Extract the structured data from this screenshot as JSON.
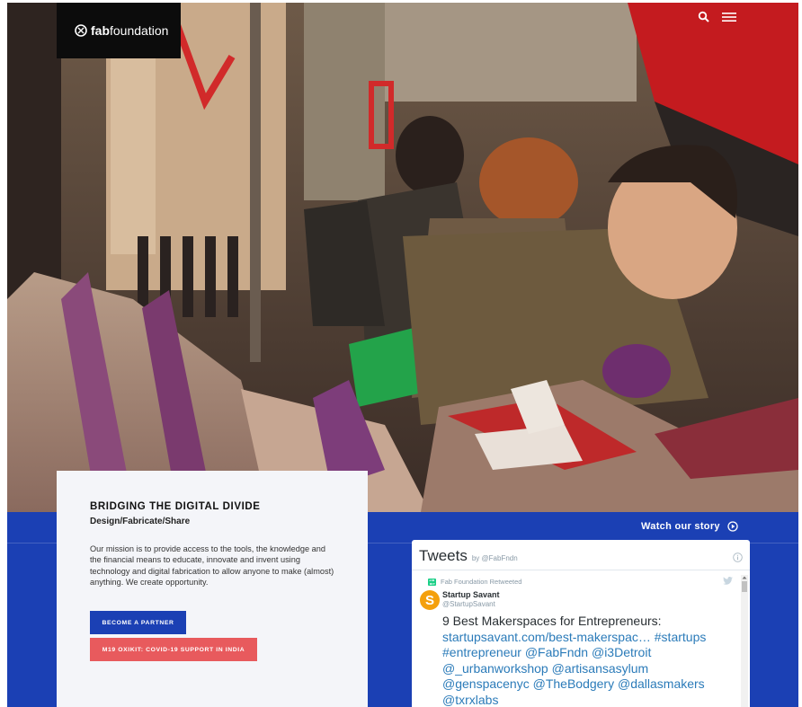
{
  "header": {
    "logo_bold": "fab",
    "logo_light": "foundation"
  },
  "hero": {
    "watch_label": "Watch our story"
  },
  "mission": {
    "title": "BRIDGING THE DIGITAL DIVIDE",
    "subtitle": "Design/Fabricate/Share",
    "text": "Our mission is to provide access to the tools, the knowledge and the financial means to educate, innovate and invent using technology and digital fabrication to allow anyone to make (almost) anything. We create opportunity.",
    "partner_button": "BECOME A PARTNER",
    "covid_button": "M19 OXIKIT: COVID-19 SUPPORT IN INDIA"
  },
  "tweets": {
    "title": "Tweets",
    "by": "by",
    "handle": "@FabFndn",
    "retweeted_by": "Fab Foundation Retweeted",
    "author_name": "Startup Savant",
    "author_handle": "@StartupSavant",
    "avatar_letter": "S",
    "text_plain": "9 Best Makerspaces for Entrepreneurs:",
    "link_url": "startupsavant.com/best-makerspac…",
    "hashtag_1": "#startups",
    "hashtag_2": "#entrepreneur",
    "mention_1": "@FabFndn",
    "mention_2": "@i3Detroit",
    "mention_3": "@_urbanworkshop",
    "mention_4": "@artisansasylum",
    "mention_5": "@genspacenyc",
    "mention_6": "@TheBodgery",
    "mention_7": "@dallasmakers",
    "mention_8": "@txrxlabs"
  },
  "colors": {
    "brand_blue": "#1b40b4",
    "accent_red": "#e85a5d",
    "logo_bg": "#0c0c0c",
    "card_bg": "#f4f5f9",
    "twitter_link": "#2b7bb9",
    "avatar_orange": "#f4a00c"
  },
  "icons": {
    "logo": "fab-foundation-logo-icon",
    "search": "search-icon",
    "menu": "hamburger-menu-icon",
    "play": "play-circle-icon",
    "info": "info-icon",
    "retweet": "retweet-icon",
    "bird": "twitter-bird-icon"
  }
}
